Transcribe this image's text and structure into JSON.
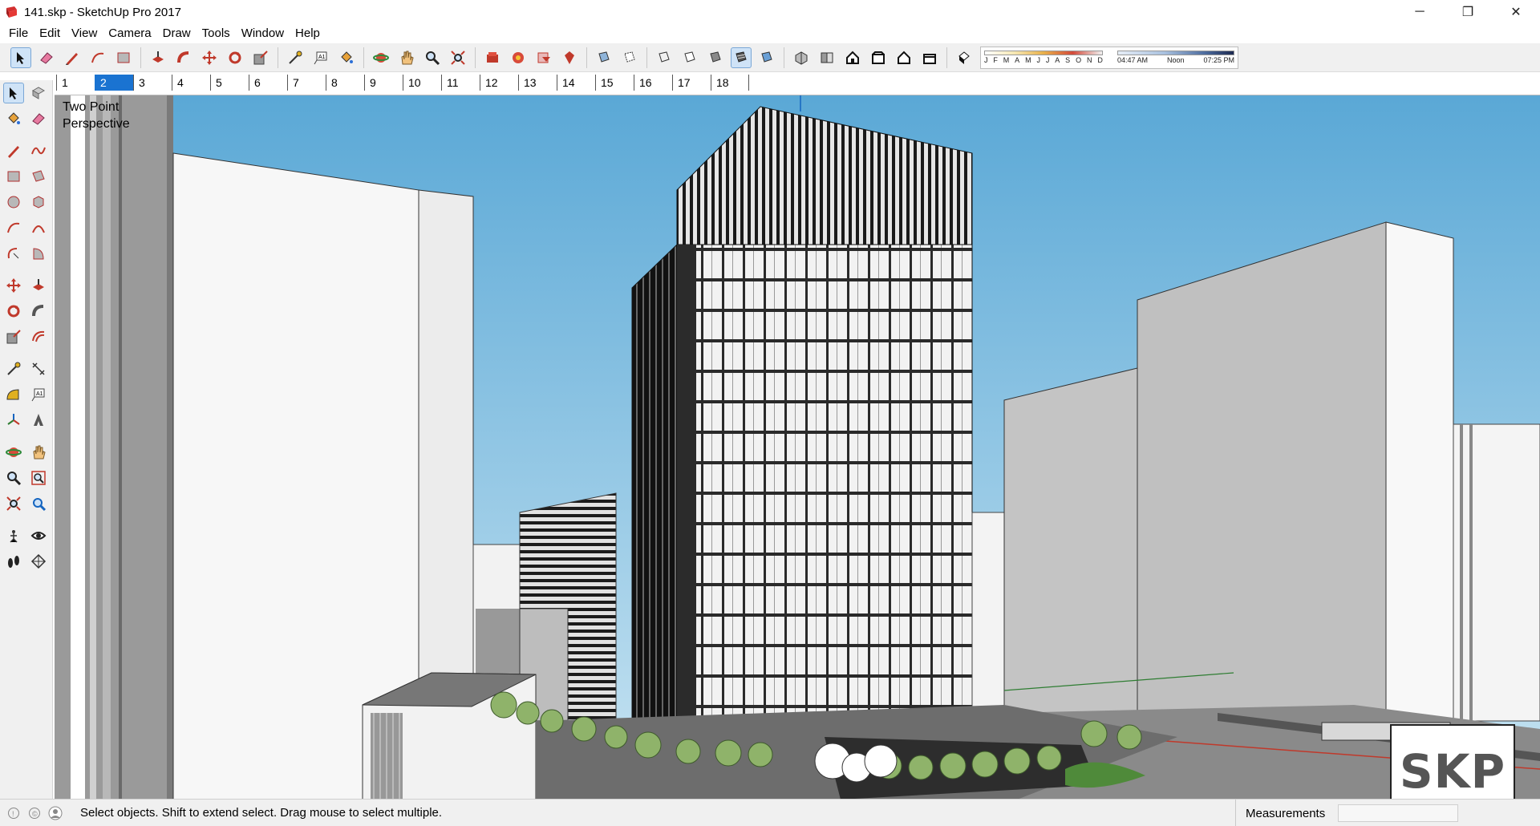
{
  "window": {
    "title": "141.skp - SketchUp Pro 2017",
    "app_icon": "sketchup-logo-icon",
    "buttons": {
      "minimize": "─",
      "restore": "❐",
      "close": "✕"
    }
  },
  "menu": [
    "File",
    "Edit",
    "View",
    "Camera",
    "Draw",
    "Tools",
    "Window",
    "Help"
  ],
  "toolbar": {
    "icons": [
      "select-icon",
      "eraser-icon",
      "pencil-line-icon",
      "arc-icon",
      "rectangle-icon",
      "push-pull-icon",
      "follow-me-icon",
      "move-icon",
      "rotate-icon",
      "scale-icon",
      "tape-measure-icon",
      "text-icon",
      "paint-bucket-icon",
      "orbit-icon",
      "pan-icon",
      "zoom-icon",
      "zoom-extents-icon",
      "3d-warehouse-icon",
      "extension-warehouse-icon",
      "layout-icon",
      "extension-manager-icon",
      "xray-icon",
      "back-edges-icon",
      "wireframe-icon",
      "hidden-line-icon",
      "shaded-icon",
      "shaded-textures-icon",
      "monochrome-icon",
      "iso-view-icon",
      "top-view-icon",
      "front-view-icon",
      "right-view-icon",
      "back-view-icon",
      "left-view-icon",
      "shadows-toggle-icon"
    ],
    "shadow_months": [
      "J",
      "F",
      "M",
      "A",
      "M",
      "J",
      "J",
      "A",
      "S",
      "O",
      "N",
      "D"
    ],
    "shadow_time": {
      "start": "04:47 AM",
      "mid": "Noon",
      "end": "07:25 PM"
    }
  },
  "scenes": {
    "tabs": [
      "1",
      "2",
      "3",
      "4",
      "5",
      "6",
      "7",
      "8",
      "9",
      "10",
      "11",
      "12",
      "13",
      "14",
      "15",
      "16",
      "17",
      "18"
    ],
    "active": "2"
  },
  "left_toolbar": {
    "rows": [
      [
        "select-icon",
        "component-icon"
      ],
      [
        "paint-bucket-icon",
        "eraser-icon"
      ],
      [
        "line-icon",
        "freehand-icon"
      ],
      [
        "rectangle-icon",
        "rotated-rectangle-icon"
      ],
      [
        "circle-icon",
        "polygon-icon"
      ],
      [
        "arc-icon",
        "two-point-arc-icon"
      ],
      [
        "three-point-arc-icon",
        "pie-icon"
      ],
      [
        "move-icon",
        "push-pull-icon"
      ],
      [
        "rotate-icon",
        "follow-me-icon"
      ],
      [
        "scale-icon",
        "offset-icon"
      ],
      [
        "tape-measure-icon",
        "dimension-icon"
      ],
      [
        "protractor-icon",
        "text-icon"
      ],
      [
        "axes-icon",
        "3d-text-icon"
      ],
      [
        "orbit-icon",
        "pan-icon"
      ],
      [
        "zoom-icon",
        "zoom-window-icon"
      ],
      [
        "zoom-extents-icon",
        "previous-view-icon"
      ],
      [
        "position-camera-icon",
        "look-around-icon"
      ],
      [
        "walk-icon",
        "section-plane-icon"
      ]
    ]
  },
  "viewport": {
    "view_label_line1": "Two Point",
    "view_label_line2": "Perspective",
    "sky_top": "#5aa8d6",
    "sky_bottom": "#c8e4f2"
  },
  "status": {
    "text": "Select objects. Shift to extend select. Drag mouse to select multiple.",
    "icons": [
      "geo-location-icon",
      "credits-icon",
      "user-icon"
    ],
    "measurements_label": "Measurements",
    "measurements_value": ""
  },
  "watermark": {
    "text": "SKP"
  }
}
